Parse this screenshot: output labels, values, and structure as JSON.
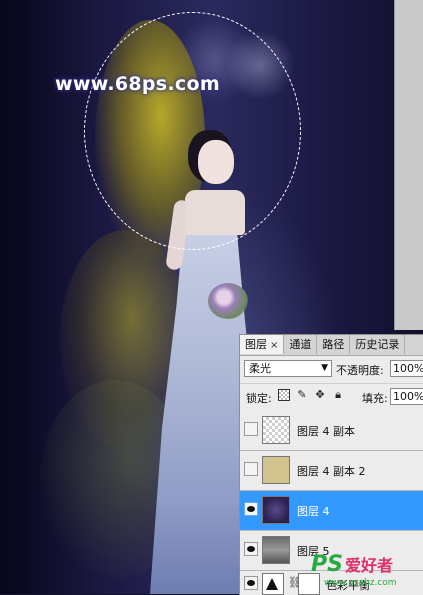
{
  "watermark": {
    "text": "www.68ps.com"
  },
  "layers_panel": {
    "tabs": [
      {
        "label": "图层",
        "close": "×"
      },
      {
        "label": "通道"
      },
      {
        "label": "路径"
      },
      {
        "label": "历史记录"
      }
    ],
    "blend_mode": "柔光",
    "opacity_label": "不透明度:",
    "opacity_value": "100%",
    "lock_label": "锁定:",
    "fill_label": "填充:",
    "fill_value": "100%",
    "layers": [
      {
        "name": "图层 4 副本",
        "visible": false,
        "thumb": "transparent"
      },
      {
        "name": "图层 4 副本 2",
        "visible": false,
        "thumb": "beige"
      },
      {
        "name": "图层 4",
        "visible": true,
        "thumb": "purple",
        "selected": true
      },
      {
        "name": "图层 5",
        "visible": true,
        "thumb": "gray"
      }
    ],
    "adjustment_layer": {
      "name": "色彩平衡",
      "visible": true
    }
  },
  "logo": {
    "ps": "PS",
    "cn": "爱好者",
    "url": "www.psahz.com"
  },
  "colors": {
    "selection": "#3399ff",
    "panel_bg": "#ececec",
    "watermark_glow": "#3a3a9a"
  }
}
